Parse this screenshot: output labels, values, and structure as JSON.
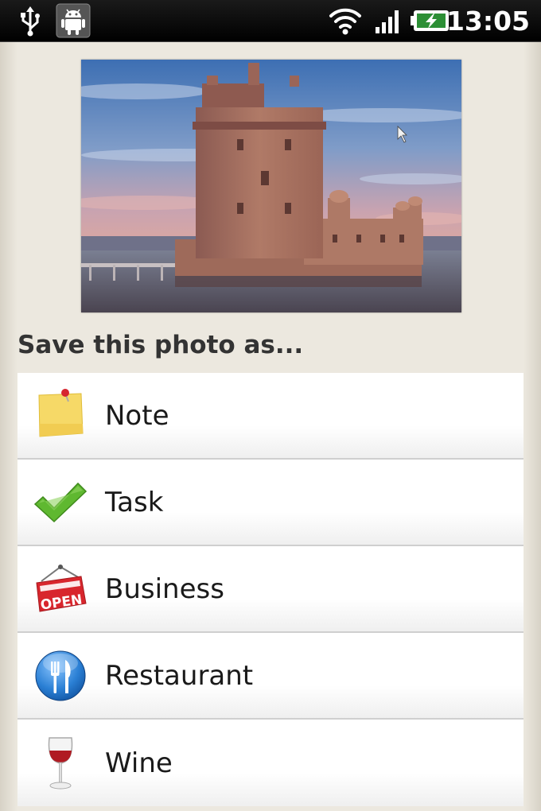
{
  "status_bar": {
    "time": "13:05",
    "icons": [
      "usb-icon",
      "android-debug-icon",
      "wifi-icon",
      "signal-icon",
      "battery-charging-icon"
    ]
  },
  "photo": {
    "subject": "tower-photo"
  },
  "section_title": "Save this photo as...",
  "options": [
    {
      "label": "Note",
      "icon": "sticky-note-icon"
    },
    {
      "label": "Task",
      "icon": "checkmark-icon"
    },
    {
      "label": "Business",
      "icon": "open-sign-icon"
    },
    {
      "label": "Restaurant",
      "icon": "fork-knife-icon"
    },
    {
      "label": "Wine",
      "icon": "wine-glass-icon"
    }
  ],
  "colors": {
    "status_bar": "#000000",
    "background": "#ece8df",
    "list_item": "#ffffff",
    "checkmark": "#5fb830",
    "open_sign": "#d8262d",
    "restaurant_blue": "#2a7fd4",
    "wine": "#b01a22"
  }
}
